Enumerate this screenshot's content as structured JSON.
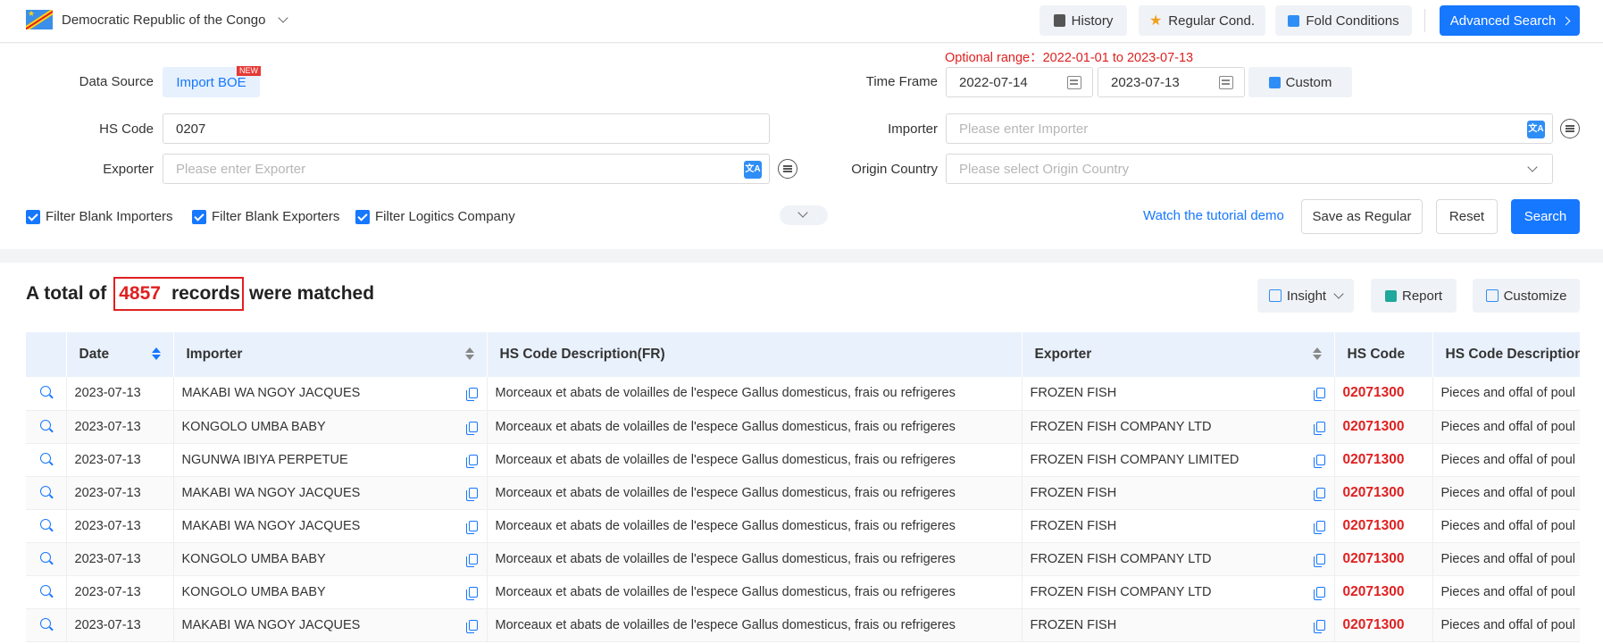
{
  "header": {
    "country": "Democratic Republic of the Congo",
    "buttons": {
      "history": "History",
      "regular": "Regular Cond.",
      "fold": "Fold Conditions",
      "advanced": "Advanced Search"
    }
  },
  "filters": {
    "range_note": "Optional range：2022-01-01 to 2023-07-13",
    "data_source_label": "Data Source",
    "data_source_value": "Import BOE",
    "new_badge": "NEW",
    "time_frame_label": "Time Frame",
    "date_from": "2022-07-14",
    "date_to": "2023-07-13",
    "custom_label": "Custom",
    "hs_code_label": "HS Code",
    "hs_code_value": "0207",
    "importer_label": "Importer",
    "importer_placeholder": "Please enter Importer",
    "exporter_label": "Exporter",
    "exporter_placeholder": "Please enter Exporter",
    "origin_label": "Origin Country",
    "origin_placeholder": "Please select Origin Country",
    "checkboxes": [
      "Filter Blank Importers",
      "Filter Blank Exporters",
      "Filter Logitics Company"
    ],
    "tutorial": "Watch the tutorial demo",
    "save_regular": "Save as Regular",
    "reset": "Reset",
    "search": "Search"
  },
  "results": {
    "prefix": "A total of",
    "count": "4857",
    "records": "records",
    "suffix": "were matched",
    "insight": "Insight",
    "report": "Report",
    "customize": "Customize",
    "columns": [
      "Date",
      "Importer",
      "HS Code Description(FR)",
      "Exporter",
      "HS Code",
      "HS Code Description"
    ],
    "rows": [
      {
        "date": "2023-07-13",
        "importer": "MAKABI WA NGOY JACQUES",
        "desc_fr": "Morceaux et abats de volailles de l'espece Gallus domesticus, frais ou refrigeres",
        "exporter": "FROZEN FISH",
        "hs": "02071300",
        "desc": "Pieces and offal of poul"
      },
      {
        "date": "2023-07-13",
        "importer": "KONGOLO UMBA BABY",
        "desc_fr": "Morceaux et abats de volailles de l'espece Gallus domesticus, frais ou refrigeres",
        "exporter": "FROZEN FISH COMPANY LTD",
        "hs": "02071300",
        "desc": "Pieces and offal of poul"
      },
      {
        "date": "2023-07-13",
        "importer": "NGUNWA IBIYA PERPETUE",
        "desc_fr": "Morceaux et abats de volailles de l'espece Gallus domesticus, frais ou refrigeres",
        "exporter": "FROZEN FISH COMPANY LIMITED",
        "hs": "02071300",
        "desc": "Pieces and offal of poul"
      },
      {
        "date": "2023-07-13",
        "importer": "MAKABI WA NGOY JACQUES",
        "desc_fr": "Morceaux et abats de volailles de l'espece Gallus domesticus, frais ou refrigeres",
        "exporter": "FROZEN FISH",
        "hs": "02071300",
        "desc": "Pieces and offal of poul"
      },
      {
        "date": "2023-07-13",
        "importer": "MAKABI WA NGOY JACQUES",
        "desc_fr": "Morceaux et abats de volailles de l'espece Gallus domesticus, frais ou refrigeres",
        "exporter": "FROZEN FISH",
        "hs": "02071300",
        "desc": "Pieces and offal of poul"
      },
      {
        "date": "2023-07-13",
        "importer": "KONGOLO UMBA BABY",
        "desc_fr": "Morceaux et abats de volailles de l'espece Gallus domesticus, frais ou refrigeres",
        "exporter": "FROZEN FISH COMPANY LTD",
        "hs": "02071300",
        "desc": "Pieces and offal of poul"
      },
      {
        "date": "2023-07-13",
        "importer": "KONGOLO UMBA BABY",
        "desc_fr": "Morceaux et abats de volailles de l'espece Gallus domesticus, frais ou refrigeres",
        "exporter": "FROZEN FISH COMPANY LTD",
        "hs": "02071300",
        "desc": "Pieces and offal of poul"
      },
      {
        "date": "2023-07-13",
        "importer": "MAKABI WA NGOY JACQUES",
        "desc_fr": "Morceaux et abats de volailles de l'espece Gallus domesticus, frais ou refrigeres",
        "exporter": "FROZEN FISH",
        "hs": "02071300",
        "desc": "Pieces and offal of poul"
      }
    ]
  }
}
